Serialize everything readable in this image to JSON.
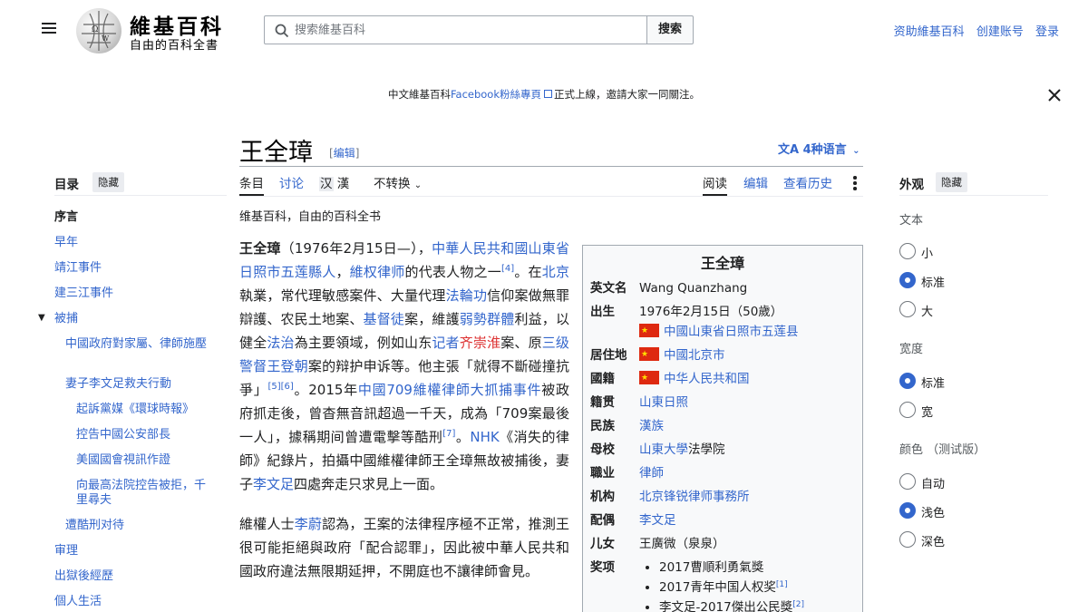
{
  "header": {
    "wordmark": "維基百科",
    "tagline": "自由的百科全書",
    "search_placeholder": "搜索維基百科",
    "search_button": "搜索",
    "user_links": [
      "资助維基百科",
      "创建账号",
      "登录"
    ]
  },
  "banner": {
    "before": "中文維基百科",
    "link": "Facebook粉絲專頁",
    "after": "正式上線，邀請大家一同關注。"
  },
  "title": {
    "text": "王全璋",
    "edit_open": "[",
    "edit": "编辑",
    "edit_close": "]",
    "languages": "4种语言"
  },
  "tabs": {
    "article": "条目",
    "talk": "讨论",
    "variant_a": "汉",
    "variant_b": "漢",
    "convert": "不转换",
    "read": "阅读",
    "edit": "编辑",
    "history": "查看历史"
  },
  "site_sub": "维基百科，自由的百科全书",
  "toc": {
    "heading": "目录",
    "hide": "隐藏",
    "items": [
      "序言",
      "早年",
      "靖江事件",
      "建三江事件",
      "被捕",
      "中國政府對家屬、律師施壓",
      "妻子李文足救夫行動",
      "起訴黨媒《環球時報》",
      "控告中國公安部長",
      "美國國會視訊作證",
      "向最高法院控告被拒，千里尋夫",
      "遭酷刑对待",
      "审理",
      "出獄後經歷",
      "個人生活"
    ]
  },
  "article": {
    "p1": {
      "name": "王全璋",
      "t1": "（1976年2月15日—），",
      "l1": "中華人民共和國山東省日照市五莲縣人",
      "t2": "，",
      "l2": "維权律师",
      "t3": "的代表人物之一",
      "r1": "[4]",
      "t4": "。在",
      "l3": "北京",
      "t5": "執業，常代理敏感案件、大量代理",
      "l4": "法輪功",
      "t6": "信仰案做無罪辯護、农民土地案、",
      "l5": "基督徒",
      "t7": "案，維護",
      "l6": "弱勢群體",
      "t8": "利益，以健全",
      "l7": "法治",
      "t9": "為主要領域，例如山东",
      "l8": "记者",
      "red": "齐崇淮",
      "t10": "案、原",
      "l9": "三级警督",
      "l10": "王登朝",
      "t11": "案的辩护申诉等。他主張「就得不斷碰撞抗爭」",
      "r2": "[5]",
      "r3": "[6]",
      "t12": "。2015年",
      "l11": "中國709維權律師大抓捕事件",
      "t13": "被政府抓走後，曾杳無音訊超過一千天，成為「709案最後一人」，據稱期间曾遭電擊等酷刑",
      "r4": "[7]",
      "t14": "。",
      "l12": "NHK",
      "t15": "《消失的律師》紀錄片，拍攝中國維權律師王全璋無故被捕後，妻子",
      "l13": "李文足",
      "t16": "四處奔走只求見上一面。"
    },
    "p2": {
      "t1": "維權人士",
      "l1": "李蔚",
      "t2": "認為，王案的法律程序極不正常，推測王很可能拒絕與政府「配合認罪」，因此被中華人民共和國政府違法無限期延押，不開庭也不讓律師會見。"
    }
  },
  "infobox": {
    "title": "王全璋",
    "rows": [
      {
        "k": "英文名",
        "v": "Wang Quanzhang"
      },
      {
        "k": "出生",
        "v": "1976年2月15日（50歲）",
        "v2": "中國山東省日照市五莲县"
      },
      {
        "k": "居住地",
        "v": "中國北京市"
      },
      {
        "k": "國籍",
        "v": "中华人民共和国"
      },
      {
        "k": "籍贯",
        "v": "山東日照"
      },
      {
        "k": "民族",
        "v": "漢族"
      },
      {
        "k": "母校",
        "v": "山東大學",
        "v_tail": "法學院"
      },
      {
        "k": "職业",
        "v": "律師"
      },
      {
        "k": "机构",
        "v": "北京锋锐律师事務所"
      },
      {
        "k": "配偶",
        "v": "李文足"
      },
      {
        "k": "儿女",
        "v": "王廣微（泉泉）"
      },
      {
        "k": "奖项",
        "awards": [
          "2017曹順利勇氣獎",
          "2017青年中国人权奖",
          "李文足-2017傑出公民獎"
        ],
        "refs": [
          "",
          "[1]",
          "[2]"
        ]
      }
    ]
  },
  "appearance": {
    "heading": "外观",
    "hide": "隐藏",
    "text_label": "文本",
    "text_options": [
      "小",
      "标准",
      "大"
    ],
    "text_selected": "标准",
    "width_label": "宽度",
    "width_options": [
      "标准",
      "宽"
    ],
    "width_selected": "标准",
    "color_label": "颜色 （测试版）",
    "color_options": [
      "自动",
      "浅色",
      "深色"
    ],
    "color_selected": "浅色"
  },
  "colors": {
    "link": "#3366cc",
    "text": "#202122",
    "accent": "#3366cc"
  }
}
